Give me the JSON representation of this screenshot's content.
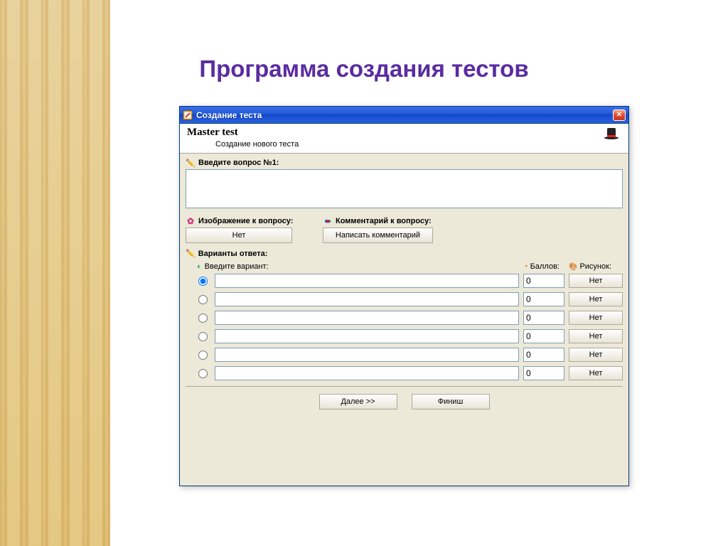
{
  "slide": {
    "title": "Программа создания тестов"
  },
  "window": {
    "title": "Создание теста",
    "header_title": "Master test",
    "header_subtitle": "Создание нового теста"
  },
  "question": {
    "label": "Введите вопрос №1:",
    "value": ""
  },
  "image_section": {
    "label": "Изображение к вопросу:",
    "button": "Нет"
  },
  "comment_section": {
    "label": "Комментарий к вопросу:",
    "button": "Написать комментарий"
  },
  "answers": {
    "header": "Варианты ответа:",
    "col_variant": "Введите вариант:",
    "col_score": "Баллов:",
    "col_image": "Рисунок:",
    "rows": [
      {
        "selected": true,
        "variant": "",
        "score": "0",
        "image_btn": "Нет"
      },
      {
        "selected": false,
        "variant": "",
        "score": "0",
        "image_btn": "Нет"
      },
      {
        "selected": false,
        "variant": "",
        "score": "0",
        "image_btn": "Нет"
      },
      {
        "selected": false,
        "variant": "",
        "score": "0",
        "image_btn": "Нет"
      },
      {
        "selected": false,
        "variant": "",
        "score": "0",
        "image_btn": "Нет"
      },
      {
        "selected": false,
        "variant": "",
        "score": "0",
        "image_btn": "Нет"
      }
    ]
  },
  "footer": {
    "next": "Далее >>",
    "finish": "Финиш"
  }
}
